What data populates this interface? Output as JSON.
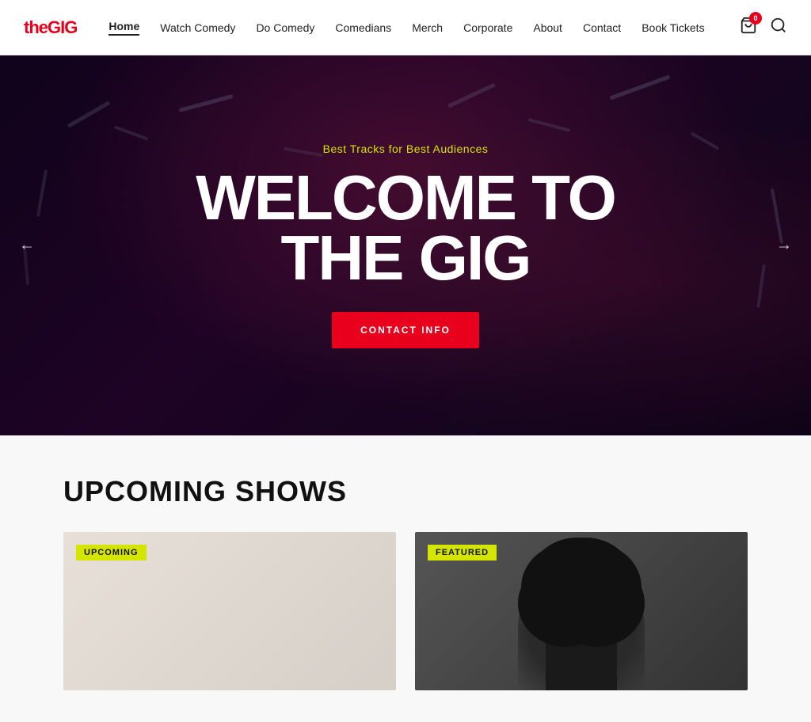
{
  "logo": {
    "prefix": "the",
    "brand": "GIG"
  },
  "nav": {
    "items": [
      {
        "label": "Home",
        "active": true
      },
      {
        "label": "Watch Comedy",
        "active": false
      },
      {
        "label": "Do Comedy",
        "active": false
      },
      {
        "label": "Comedians",
        "active": false
      },
      {
        "label": "Merch",
        "active": false
      },
      {
        "label": "Corporate",
        "active": false
      },
      {
        "label": "About",
        "active": false
      },
      {
        "label": "Contact",
        "active": false
      },
      {
        "label": "Book Tickets",
        "active": false
      }
    ]
  },
  "cart": {
    "badge": "0"
  },
  "hero": {
    "subtitle": "Best Tracks for Best Audiences",
    "title_line1": "WELCOME TO",
    "title_line2": "THE GIG",
    "cta_label": "CONTACT INFO",
    "arrow_left": "←",
    "arrow_right": "→"
  },
  "upcoming": {
    "section_title": "UPCOMING SHOWS",
    "shows": [
      {
        "tag": "UPCOMING",
        "side": "left"
      },
      {
        "tag": "FEATURED",
        "side": "right"
      }
    ]
  }
}
